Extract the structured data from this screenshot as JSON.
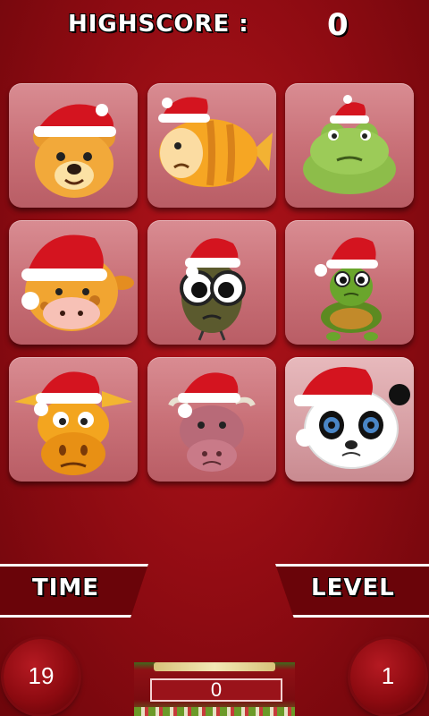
{
  "header": {
    "highscore_label": "HIGHSCORE :",
    "highscore_value": "0"
  },
  "tiles": [
    {
      "name": "teddy-bear-card-icon",
      "animal": "teddy bear",
      "face_color": "#f2a93a"
    },
    {
      "name": "fish-card-icon",
      "animal": "fish",
      "face_color": "#f6a623"
    },
    {
      "name": "frog-card-icon",
      "animal": "frog",
      "face_color": "#8dbd4a"
    },
    {
      "name": "giraffe-card-icon",
      "animal": "giraffe",
      "face_color": "#f1a531"
    },
    {
      "name": "bug-card-icon",
      "animal": "bug",
      "face_color": "#5b5a2e"
    },
    {
      "name": "turtle-card-icon",
      "animal": "turtle",
      "face_color": "#6aa52c"
    },
    {
      "name": "cow-card-icon",
      "animal": "cow",
      "face_color": "#f3a51f"
    },
    {
      "name": "bull-card-icon",
      "animal": "bull",
      "face_color": "#b86a78"
    },
    {
      "name": "panda-card-icon",
      "animal": "panda",
      "face_color": "#ffffff"
    }
  ],
  "labels": {
    "time": "TIME",
    "level": "LEVEL"
  },
  "counters": {
    "time_value": "19",
    "level_value": "1"
  },
  "ad": {
    "score_value": "0"
  },
  "colors": {
    "background": "#a4111a",
    "tile": "#c97178",
    "santa_hat": "#d4141f",
    "hat_trim": "#ffffff"
  }
}
